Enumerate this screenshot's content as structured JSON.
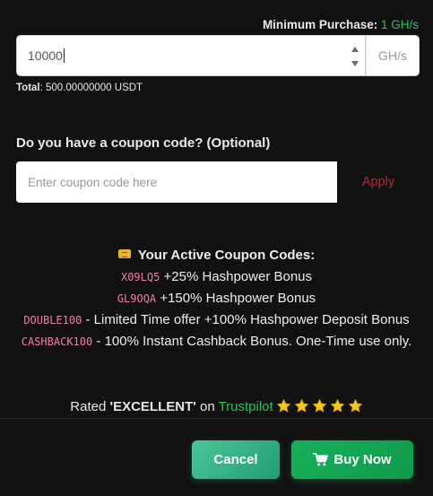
{
  "purchase": {
    "min_label": "Minimum Purchase:",
    "min_value": "1 GH/s",
    "amount_value": "10000",
    "unit": "GH/s",
    "total_label": "Total",
    "total_value": ": 500.00000000 USDT"
  },
  "coupon": {
    "question": "Do you have a coupon code? (Optional)",
    "placeholder": "Enter coupon code here",
    "apply_label": "Apply"
  },
  "active_coupons": {
    "title": "Your Active Coupon Codes:",
    "icon": "ticket-icon",
    "items": [
      {
        "code": "X09LQ5",
        "desc": " +25% Hashpower Bonus"
      },
      {
        "code": "GL9OQA",
        "desc": " +150% Hashpower Bonus"
      },
      {
        "code": "DOUBLE100",
        "desc": " - Limited Time offer +100% Hashpower Deposit Bonus"
      },
      {
        "code": "CASHBACK100",
        "desc": " - 100% Instant Cashback Bonus. One-Time use only."
      }
    ]
  },
  "rating": {
    "prefix": "Rated ",
    "grade": "'EXCELLENT'",
    "on": " on ",
    "platform": "Trustpilot",
    "stars": 5,
    "star_color": "#f5c518"
  },
  "actions": {
    "cancel_label": "Cancel",
    "buy_label": "Buy Now",
    "buy_icon": "cart-icon"
  },
  "colors": {
    "background": "#111111",
    "accent_green": "#22c55e",
    "apply_red": "#c21f2c",
    "coupon_code_pink": "#f07ea8"
  }
}
